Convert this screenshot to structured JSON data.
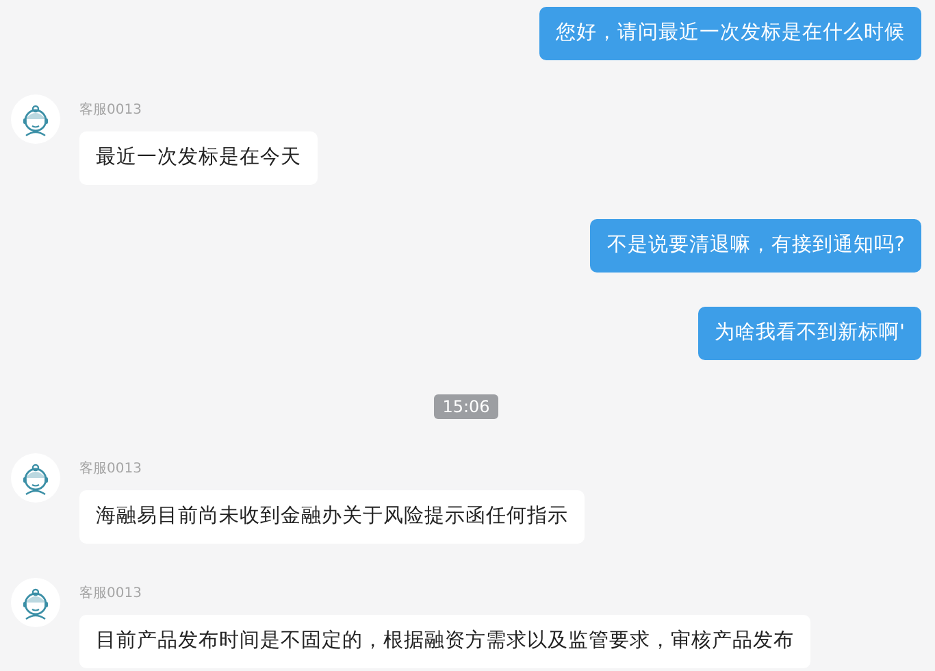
{
  "messages": [
    {
      "kind": "user",
      "text": "您好，请问最近一次发标是在什么时候"
    },
    {
      "kind": "agent",
      "sender": "客服0013",
      "text": "最近一次发标是在今天"
    },
    {
      "kind": "user",
      "text": "不是说要清退嘛，有接到通知吗?"
    },
    {
      "kind": "user",
      "text": "为啥我看不到新标啊'"
    },
    {
      "kind": "time",
      "text": "15:06"
    },
    {
      "kind": "agent",
      "sender": "客服0013",
      "text": "海融易目前尚未收到金融办关于风险提示函任何指示"
    },
    {
      "kind": "agent",
      "sender": "客服0013",
      "text": "目前产品发布时间是不固定的，根据融资方需求以及监管要求，审核产品发布"
    }
  ]
}
